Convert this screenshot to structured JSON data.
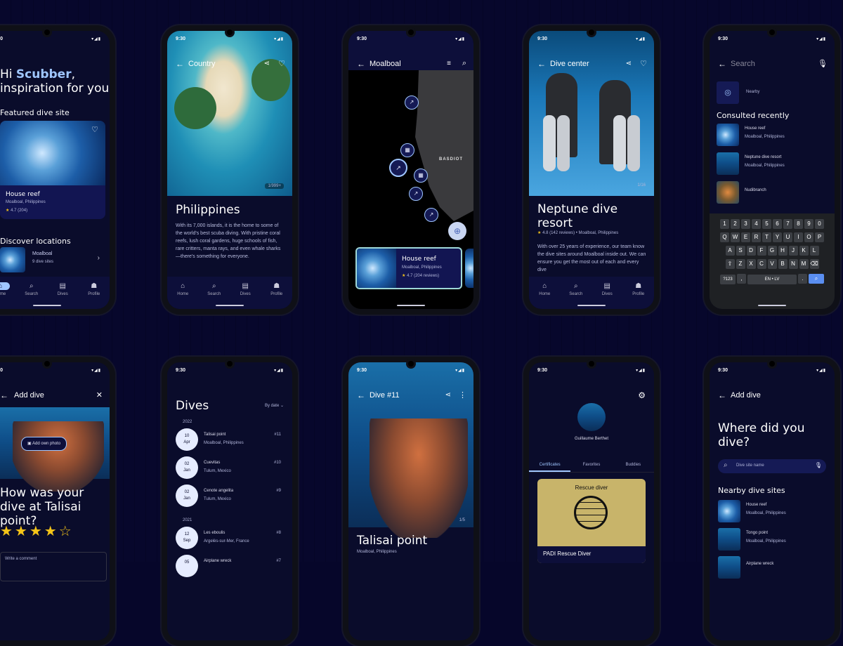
{
  "status_time": "9:30",
  "nav": {
    "home": "Home",
    "search": "Search",
    "dives": "Dives",
    "profile": "Profile"
  },
  "p1": {
    "greeting_prefix": "Hi ",
    "greeting_name": "Scubber",
    "greeting_suffix": ",",
    "subtitle": "inspiration for you",
    "featured": "Featured dive site",
    "site_name": "House reef",
    "site_loc": "Moalboal, Philippines",
    "rating": "4.7 (204)",
    "discover": "Discover locations",
    "loc_name": "Moalboal",
    "loc_count": "9 dive sites"
  },
  "p2": {
    "top": "Country",
    "counter": "1/999+",
    "title": "Philippines",
    "desc": "With its 7,000 islands, it is the home to some of the world's best scuba diving. With pristine coral reefs, lush coral gardens, huge schools of fish, rare critters, manta rays, and even whale sharks—there's something for everyone."
  },
  "p3": {
    "top": "Moalboal",
    "map_label": "BASDIOT",
    "card_title": "House reef",
    "card_loc": "Moalboal, Philippines",
    "card_rating": "4.7 (204 reviews)"
  },
  "p4": {
    "top": "Dive center",
    "counter": "1/16",
    "title": "Neptune dive resort",
    "rating": "4.8 (142 reviews)",
    "loc": "Moalboal, Philippines",
    "desc": "With over 25 years of experience, our team know the dive sites around Moalboal inside out. We can ensure you get the most out of each and every dive"
  },
  "p5": {
    "search_placeholder": "Search",
    "nearby": "Nearby",
    "consulted": "Consulted recently",
    "items": [
      {
        "name": "House reef",
        "loc": "Moalboal, Philippines"
      },
      {
        "name": "Neptune dive resort",
        "loc": "Moalboal, Philippines"
      },
      {
        "name": "Nudibranch",
        "loc": ""
      }
    ],
    "kb_row1": [
      "1",
      "2",
      "3",
      "4",
      "5",
      "6",
      "7",
      "8",
      "9",
      "0"
    ],
    "kb_row2": [
      "Q",
      "W",
      "E",
      "R",
      "T",
      "Y",
      "U",
      "I",
      "O",
      "P"
    ],
    "kb_row3": [
      "A",
      "S",
      "D",
      "F",
      "G",
      "H",
      "J",
      "K",
      "L"
    ],
    "kb_row4": [
      "Z",
      "X",
      "C",
      "V",
      "B",
      "N",
      "M"
    ],
    "kb_sym": "?123",
    "kb_lang": "EN • LV"
  },
  "p6": {
    "top": "Add dive",
    "photo_btn": "Add own photo",
    "question": "How was your dive at Talisai point?",
    "stars": "★★★★☆",
    "comment_placeholder": "Write a comment"
  },
  "p7": {
    "title": "Dives",
    "sort": "By date",
    "year1": "2022",
    "year2": "2021",
    "dives": [
      {
        "day": "10",
        "mon": "Apr",
        "name": "Talisai point",
        "loc": "Moalboal, Philippines",
        "num": "#11"
      },
      {
        "day": "02",
        "mon": "Jan",
        "name": "Cuevitas",
        "loc": "Tulum, Mexico",
        "num": "#10"
      },
      {
        "day": "02",
        "mon": "Jan",
        "name": "Cenote angelita",
        "loc": "Tulum, Mexico",
        "num": "#9"
      },
      {
        "day": "12",
        "mon": "Sep",
        "name": "Les eboulis",
        "loc": "Argelès-sur-Mer, France",
        "num": "#8"
      },
      {
        "day": "05",
        "mon": "",
        "name": "Airplane wreck",
        "loc": "",
        "num": "#7"
      }
    ]
  },
  "p8": {
    "top": "Dive #11",
    "counter": "1/5",
    "title": "Talisai point",
    "loc": "Moalboal, Philippines"
  },
  "p9": {
    "name": "Guillaume Berthet",
    "tabs": [
      "Certificates",
      "Favorites",
      "Buddies"
    ],
    "cert_title": "Rescue diver",
    "cert_name": "PADI Rescue Diver"
  },
  "p10": {
    "top": "Add dive",
    "question": "Where did you dive?",
    "search_placeholder": "Dive site name",
    "nearby": "Nearby dive sites",
    "items": [
      {
        "name": "House reef",
        "loc": "Moalboal, Philippines"
      },
      {
        "name": "Tongo point",
        "loc": "Moalboal, Philippines"
      },
      {
        "name": "Airplane wreck",
        "loc": ""
      }
    ]
  },
  "colors": {
    "bg": "#06062a",
    "screen": "#0a0c2b",
    "accent": "#9fc6ff",
    "gold": "#c8b46a"
  }
}
